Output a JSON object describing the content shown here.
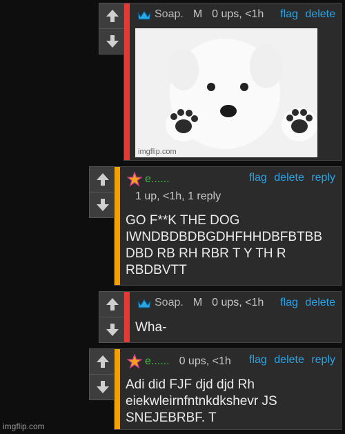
{
  "comments": [
    {
      "username": "Soap.",
      "tag": "M",
      "ups": "0 ups, <1h",
      "actions": [
        "flag",
        "delete"
      ],
      "image_watermark": "imgflip.com"
    },
    {
      "username": "e......",
      "ups_line": "1 up, <1h, 1 reply",
      "actions": [
        "flag",
        "delete",
        "reply"
      ],
      "text": [
        "GO F**K THE DOG",
        "IWNDBDBDBGDHFHHDBFBTBB",
        "DBD RB RH RBR T Y TH R",
        "RBDBVTT"
      ]
    },
    {
      "username": "Soap.",
      "tag": "M",
      "ups": "0 ups, <1h",
      "actions": [
        "flag",
        "delete"
      ],
      "text": [
        "Wha-"
      ]
    },
    {
      "username": "e......",
      "ups": "0 ups, <1h",
      "actions": [
        "flag",
        "delete",
        "reply"
      ],
      "text": [
        "Adi did FJF djd djd Rh",
        "eiekwleirnfntnkdkshevr JS",
        "SNEJEBRBF. T"
      ]
    }
  ],
  "footer_watermark": "imgflip.com",
  "icons": {
    "upvote": "up-arrow-icon",
    "downvote": "down-arrow-icon",
    "mod_badge": "crown-icon",
    "user_badge": "star-icon"
  },
  "colors": {
    "mod_bar": "#e53935",
    "user_bar": "#f5a000",
    "link": "#2aa3e6",
    "green_name": "#3fbf3f"
  }
}
